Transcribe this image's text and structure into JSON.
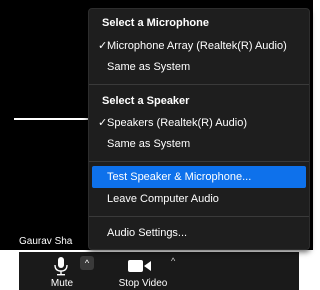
{
  "participant": {
    "name": "Gaurav Sha"
  },
  "audio_menu": {
    "microphone_heading": "Select a Microphone",
    "microphone_options": [
      {
        "label": "Microphone Array (Realtek(R) Audio)",
        "checked": true
      },
      {
        "label": "Same as System",
        "checked": false
      }
    ],
    "speaker_heading": "Select a Speaker",
    "speaker_options": [
      {
        "label": "Speakers (Realtek(R) Audio)",
        "checked": true
      },
      {
        "label": "Same as System",
        "checked": false
      }
    ],
    "actions": [
      {
        "label": "Test Speaker & Microphone...",
        "highlighted": true
      },
      {
        "label": "Leave Computer Audio",
        "highlighted": false
      }
    ],
    "settings_label": "Audio Settings...",
    "check_glyph": "✓"
  },
  "toolbar": {
    "mute_label": "Mute",
    "stop_video_label": "Stop Video",
    "caret_glyph": "^"
  },
  "colors": {
    "menu_background": "#1e1e1e",
    "highlight": "#0e71eb",
    "toolbar_background": "#1a1a1a"
  }
}
